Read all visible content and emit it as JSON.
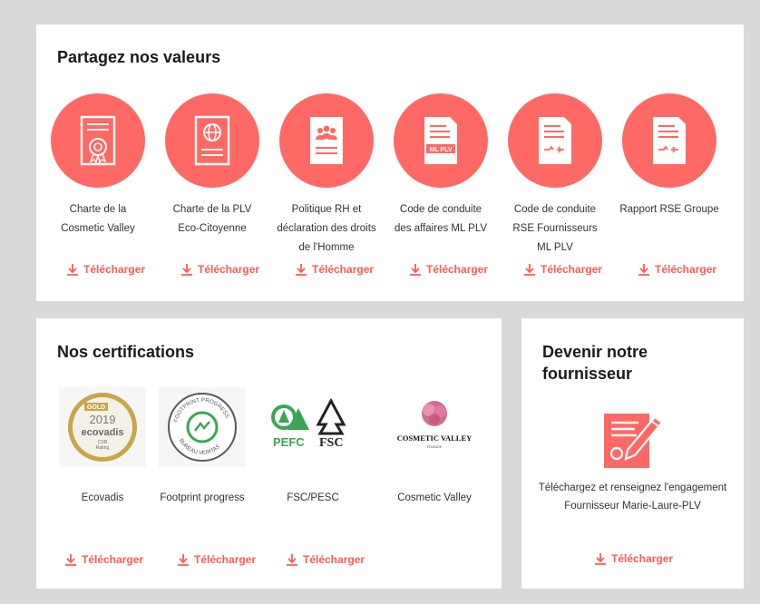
{
  "values": {
    "title": "Partagez nos valeurs",
    "documents": [
      {
        "label": "Charte de la Cosmetic Valley",
        "icon": "certificate-icon"
      },
      {
        "label": "Charte de la PLV Eco-Citoyenne",
        "icon": "globe-document-icon"
      },
      {
        "label": "Politique RH et déclaration des droits de l'Homme",
        "icon": "people-document-icon"
      },
      {
        "label": "Code de conduite des affaires ML PLV",
        "icon": "ml-plv-document-icon",
        "icon_text": "ML PLV"
      },
      {
        "label": "Code de conduite RSE Fournisseurs ML PLV",
        "icon": "handshake-document-icon"
      },
      {
        "label": "Rapport RSE Groupe",
        "icon": "handshake-document-icon"
      }
    ],
    "download_label": "Télécharger"
  },
  "certifications": {
    "title": "Nos certifications",
    "items": [
      {
        "label": "Ecovadis",
        "logo": "ecovadis-logo",
        "logo_text": [
          "GOLD",
          "2019",
          "ecovadis",
          "CSR",
          "Rating"
        ]
      },
      {
        "label": "Footprint progress",
        "logo": "footprint-progress-logo",
        "logo_text": [
          "FOOTPRINT PROGRESS",
          "BUREAU VERITAS"
        ]
      },
      {
        "label": "FSC/PESC",
        "logo": "pefc-fsc-logo",
        "logo_text": [
          "PEFC",
          "FSC"
        ]
      },
      {
        "label": "Cosmetic Valley",
        "logo": "cosmetic-valley-logo",
        "logo_text": [
          "COSMETIC VALLEY",
          "FRANCE"
        ]
      }
    ],
    "download_label": "Télécharger"
  },
  "supplier": {
    "title": "Devenir notre fournisseur",
    "text": "Téléchargez et renseignez l'engagement Fournisseur Marie-Laure-PLV",
    "download_label": "Télécharger",
    "icon": "contract-sign-icon"
  },
  "colors": {
    "accent": "#ff6965",
    "link": "#ff5a55",
    "background": "#d9d9d9",
    "card": "#ffffff"
  }
}
